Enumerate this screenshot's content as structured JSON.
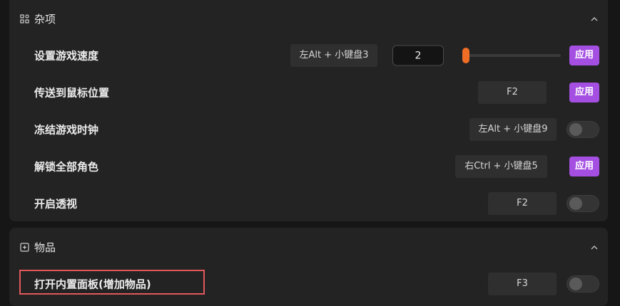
{
  "sections": {
    "misc": {
      "title": "杂项",
      "rows": [
        {
          "label": "设置游戏速度",
          "hotkey": "左Alt + 小键盘3",
          "input_value": "2",
          "slider_fraction": 0.03,
          "action_label": "应用"
        },
        {
          "label": "传送到鼠标位置",
          "hotkey": "F2",
          "action_label": "应用"
        },
        {
          "label": "冻结游戏时钟",
          "hotkey": "左Alt + 小键盘9",
          "toggle_on": false
        },
        {
          "label": "解锁全部角色",
          "hotkey": "右Ctrl + 小键盘5",
          "action_label": "应用"
        },
        {
          "label": "开启透视",
          "hotkey": "F2",
          "toggle_on": false
        }
      ]
    },
    "items": {
      "title": "物品",
      "rows": [
        {
          "label": "打开内置面板(增加物品)",
          "hotkey": "F3",
          "toggle_on": false
        }
      ]
    }
  },
  "colors": {
    "accent_purple": "#a44fe2",
    "slider_orange": "#f06d26",
    "highlight_red": "#e2575a"
  }
}
